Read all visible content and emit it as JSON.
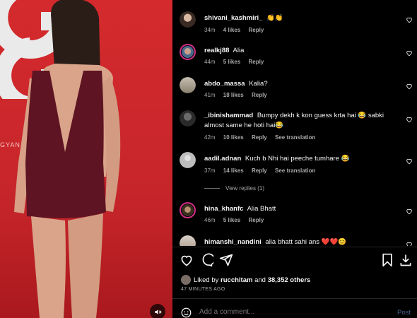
{
  "media": {
    "brand_text": "GYAN"
  },
  "comments": [
    {
      "user": "shivani_kashmiri_",
      "text": "👏👏",
      "time": "34m",
      "likes": "4 likes",
      "reply": "Reply",
      "translation": ""
    },
    {
      "user": "realkj88",
      "text": "Alia",
      "time": "44m",
      "likes": "5 likes",
      "reply": "Reply",
      "translation": ""
    },
    {
      "user": "abdo_massa",
      "text": "Kalia?",
      "time": "41m",
      "likes": "18 likes",
      "reply": "Reply",
      "translation": ""
    },
    {
      "user": "_ibinishammad",
      "text": "Bumpy dekh k kon guess krta hai 😂 sabki almost same he hoti hai😂",
      "time": "42m",
      "likes": "10 likes",
      "reply": "Reply",
      "translation": "See translation"
    },
    {
      "user": "aadil.adnan",
      "text": "Kuch b Nhi hai peeche tumhare 😂",
      "time": "37m",
      "likes": "14 likes",
      "reply": "Reply",
      "translation": "See translation"
    },
    {
      "user": "hina_khanfc",
      "text": "Alia Bhatt",
      "time": "46m",
      "likes": "5 likes",
      "reply": "Reply",
      "translation": ""
    },
    {
      "user": "himanshi_nandini",
      "text": "alia bhatt sahi ans ❤️❤️😊",
      "time": "",
      "likes": "",
      "reply": "",
      "translation": ""
    }
  ],
  "view_replies": "View replies (1)",
  "likes": {
    "prefix": "Liked by",
    "user": "rucchitam",
    "joiner": "and",
    "others": "38,352 others"
  },
  "posted_ago": "47 MINUTES AGO",
  "add_comment": {
    "placeholder": "Add a comment...",
    "post_label": "Post"
  },
  "colors": {
    "background": "#000000",
    "muted_text": "#a8a8a8",
    "post_disabled": "#4a5d8a",
    "story_ring": "#d6308a",
    "backdrop_red": "#c8262b"
  },
  "icons": [
    "mute-icon",
    "heart-icon",
    "comment-icon",
    "share-icon",
    "bookmark-icon",
    "download-icon",
    "emoji-icon"
  ]
}
